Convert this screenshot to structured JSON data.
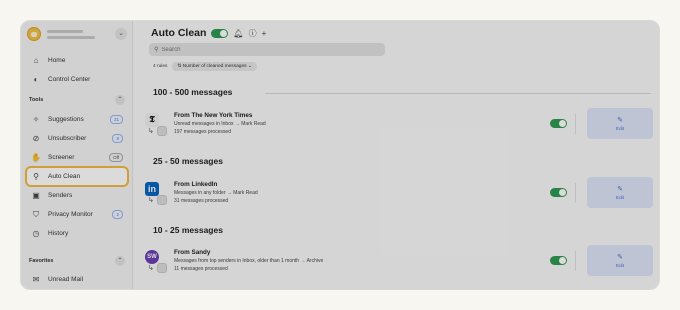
{
  "sidebar": {
    "home": "Home",
    "control_center": "Control Center",
    "tools_label": "Tools",
    "items": [
      {
        "label": "Suggestions",
        "badge": "31"
      },
      {
        "label": "Unsubscriber",
        "badge": "8"
      },
      {
        "label": "Screener",
        "badge": "Off"
      },
      {
        "label": "Auto Clean",
        "badge": ""
      },
      {
        "label": "Senders",
        "badge": ""
      },
      {
        "label": "Privacy Monitor",
        "badge": "2"
      },
      {
        "label": "History",
        "badge": ""
      }
    ],
    "favorites_label": "Favorites",
    "unread_mail": "Unread Mail"
  },
  "header": {
    "title": "Auto Clean",
    "search_placeholder": "Search",
    "rule_count": "4 rules",
    "sort_label": "Number of cleaned messages"
  },
  "groups": [
    {
      "heading": "100 - 500 messages",
      "rule": {
        "title": "From The New York Times",
        "description": "Unread messages in Inbox → Mark Read",
        "count": "197 messages processed",
        "logo": "𝕿",
        "edit": "Edit"
      }
    },
    {
      "heading": "25 - 50 messages",
      "rule": {
        "title": "From LinkedIn",
        "description": "Messages in any folder → Mark Read",
        "count": "31 messages processed",
        "logo": "in",
        "edit": "Edit"
      }
    },
    {
      "heading": "10 - 25 messages",
      "rule": {
        "title": "From Sandy",
        "description": "Messages from top senders in Inbox, older than 1 month → Archive",
        "count": "11 messages processed",
        "logo": "SW",
        "edit": "Edit"
      }
    }
  ],
  "colors": {
    "accent": "#2f9a52",
    "highlight": "#f4b942",
    "edit_bg": "#dee5f6",
    "edit_text": "#4a6ed1",
    "linkedin": "#0a66c2",
    "sandy": "#6b3fb5"
  }
}
